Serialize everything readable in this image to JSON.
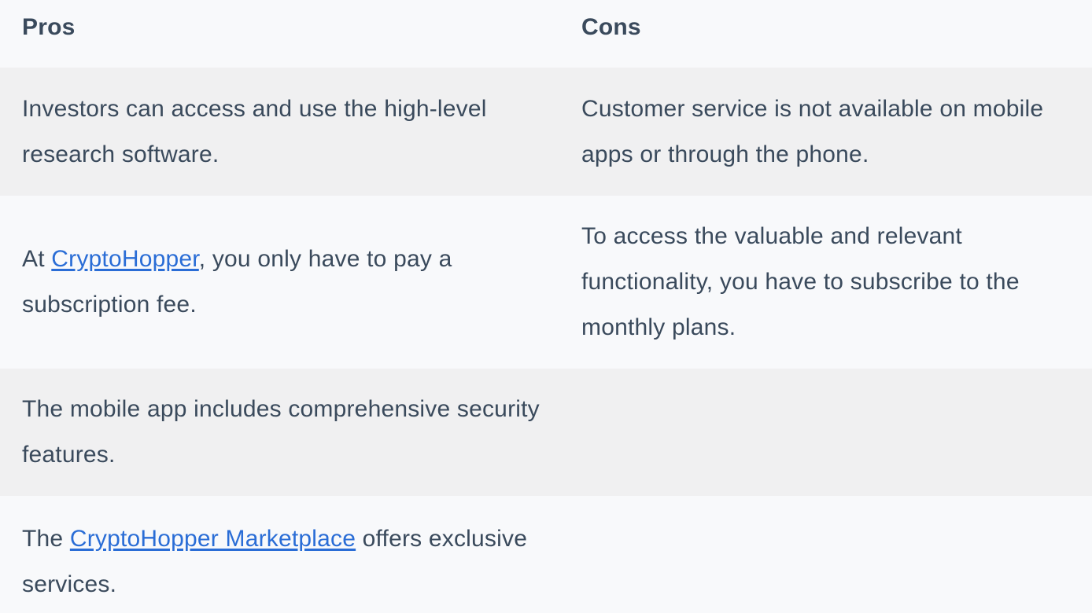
{
  "table": {
    "headers": {
      "pros": "Pros",
      "cons": "Cons"
    },
    "rows": [
      {
        "pros": {
          "text": "Investors can access and use the high-level research software."
        },
        "cons": {
          "text": "Customer service is not available on mobile apps or through the phone."
        }
      },
      {
        "pros": {
          "before": "At ",
          "link": "CryptoHopper",
          "after": ", you only have to pay a subscription fee."
        },
        "cons": {
          "text": "To access the valuable and relevant functionality, you have to subscribe to the monthly plans."
        }
      },
      {
        "pros": {
          "text": "The mobile app includes comprehensive security features."
        },
        "cons": {
          "text": ""
        }
      },
      {
        "pros": {
          "before": "The ",
          "link": "CryptoHopper Marketplace",
          "after": " offers exclusive services."
        },
        "cons": {
          "text": ""
        }
      }
    ]
  },
  "colors": {
    "text": "#3a4a5c",
    "link": "#2a6dd6",
    "row_alt": "#f0f0f1",
    "row_base": "#f8f9fb"
  }
}
